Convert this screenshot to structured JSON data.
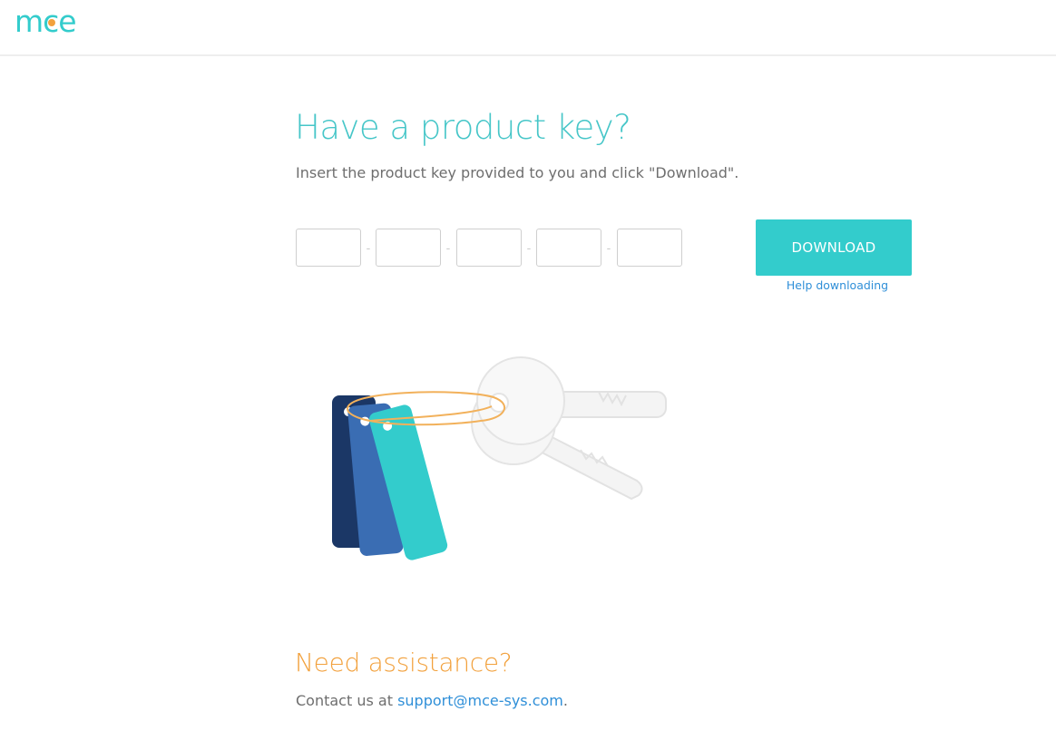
{
  "header": {
    "logo_text": "mce"
  },
  "main": {
    "title": "Have a product key?",
    "subtitle": "Insert the product key provided to you and click \"Download\".",
    "key_fields": [
      {
        "value": "",
        "placeholder": ""
      },
      {
        "value": "",
        "placeholder": ""
      },
      {
        "value": "",
        "placeholder": ""
      },
      {
        "value": "",
        "placeholder": ""
      },
      {
        "value": "",
        "placeholder": ""
      }
    ],
    "separator": "-",
    "download_label": "DOWNLOAD",
    "help_label": "Help downloading"
  },
  "assistance": {
    "title": "Need assistance?",
    "contact_prefix": "Contact us at ",
    "email": "support@mce-sys.com",
    "contact_suffix": "."
  },
  "colors": {
    "brand_teal": "#33cccc",
    "accent_orange": "#f2a13d",
    "link_blue": "#2f8fd8",
    "tag_navy": "#1b3766",
    "tag_blue": "#3a6db3",
    "tag_teal": "#33cccc"
  },
  "icons": [
    "keys-illustration-icon"
  ]
}
